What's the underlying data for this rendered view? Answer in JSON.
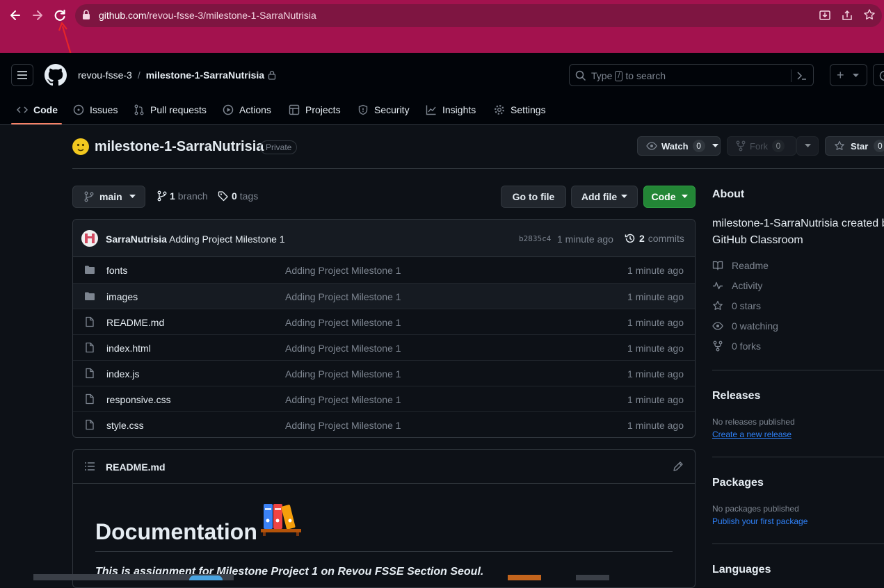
{
  "browser": {
    "url_host": "github.com",
    "url_path": "/revou-fsse-3/milestone-1-SarraNutrisia"
  },
  "header": {
    "owner": "revou-fsse-3",
    "separator": "/",
    "repo": "milestone-1-SarraNutrisia",
    "search_prefix": "Type",
    "search_key": "/",
    "search_suffix": "to search",
    "new_glyph": "+"
  },
  "tabs": [
    {
      "label": "Code",
      "icon": "code-icon"
    },
    {
      "label": "Issues",
      "icon": "issue-icon"
    },
    {
      "label": "Pull requests",
      "icon": "pull-request-icon"
    },
    {
      "label": "Actions",
      "icon": "play-icon"
    },
    {
      "label": "Projects",
      "icon": "table-icon"
    },
    {
      "label": "Security",
      "icon": "shield-icon"
    },
    {
      "label": "Insights",
      "icon": "graph-icon"
    },
    {
      "label": "Settings",
      "icon": "gear-icon"
    }
  ],
  "repo": {
    "title": "milestone-1-SarraNutrisia",
    "visibility": "Private",
    "watch_label": "Watch",
    "watch_count": "0",
    "fork_label": "Fork",
    "fork_count": "0",
    "star_label": "Star",
    "star_count": "0"
  },
  "toolbar": {
    "branch": "main",
    "branch_count": "1",
    "branch_word": "branch",
    "tag_count": "0",
    "tag_word": "tags",
    "goto_file": "Go to file",
    "add_file": "Add file",
    "code_btn": "Code"
  },
  "commit": {
    "author": "SarraNutrisia",
    "message": "Adding Project Milestone 1",
    "sha": "b2835c4",
    "age": "1 minute ago",
    "count": "2",
    "count_word": "commits"
  },
  "files": [
    {
      "name": "fonts",
      "type": "dir",
      "message": "Adding Project Milestone 1",
      "age": "1 minute ago"
    },
    {
      "name": "images",
      "type": "dir",
      "message": "Adding Project Milestone 1",
      "age": "1 minute ago"
    },
    {
      "name": "README.md",
      "type": "file",
      "message": "Adding Project Milestone 1",
      "age": "1 minute ago"
    },
    {
      "name": "index.html",
      "type": "file",
      "message": "Adding Project Milestone 1",
      "age": "1 minute ago"
    },
    {
      "name": "index.js",
      "type": "file",
      "message": "Adding Project Milestone 1",
      "age": "1 minute ago"
    },
    {
      "name": "responsive.css",
      "type": "file",
      "message": "Adding Project Milestone 1",
      "age": "1 minute ago"
    },
    {
      "name": "style.css",
      "type": "file",
      "message": "Adding Project Milestone 1",
      "age": "1 minute ago"
    }
  ],
  "readme": {
    "filename": "README.md",
    "heading": "Documentation",
    "intro": "This is assignment for Milestone Project 1 on Revou FSSE Section Seoul."
  },
  "about": {
    "title": "About",
    "description_line1": "milestone-1-SarraNutrisia created b",
    "description_line2": "GitHub Classroom",
    "items": [
      {
        "label": "Readme",
        "icon": "book-icon"
      },
      {
        "label": "Activity",
        "icon": "pulse-icon"
      },
      {
        "label": "0 stars",
        "icon": "star-icon"
      },
      {
        "label": "0 watching",
        "icon": "eye-icon"
      },
      {
        "label": "0 forks",
        "icon": "fork-icon"
      }
    ]
  },
  "releases": {
    "title": "Releases",
    "empty": "No releases published",
    "link": "Create a new release"
  },
  "packages": {
    "title": "Packages",
    "empty": "No packages published",
    "link": "Publish your first package"
  },
  "languages": {
    "title": "Languages"
  },
  "colors": {
    "chrome": "#a3124e",
    "bg": "#0d1117",
    "accent_green": "#238636",
    "link_blue": "#2f81f7",
    "tab_underline": "#f78166"
  }
}
